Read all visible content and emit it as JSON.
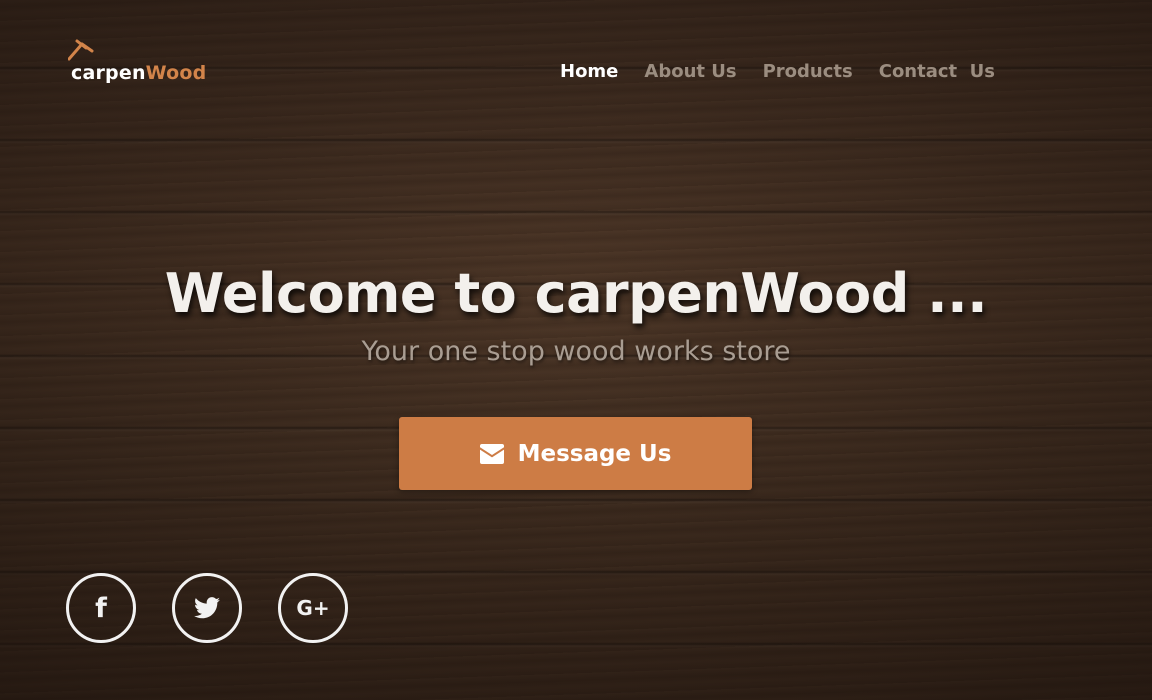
{
  "brand": {
    "name_part1": "carpen",
    "name_part2": "Wood",
    "accent_color": "#d2844a",
    "logo_icon": "hammer-roof-icon"
  },
  "nav": {
    "items": [
      {
        "label": "Home",
        "active": true
      },
      {
        "label": "About Us",
        "active": false
      },
      {
        "label": "Products",
        "active": false
      },
      {
        "label": "Contact  Us",
        "active": false
      }
    ]
  },
  "hero": {
    "title": "Welcome to carpenWood ...",
    "subtitle": "Your one stop wood works store",
    "background": "dark-wood-planks",
    "cta": {
      "label": "Message Us",
      "icon": "envelope-icon",
      "color": "#cd7c45"
    }
  },
  "social": [
    {
      "network": "facebook",
      "icon": "facebook-icon",
      "glyph": "f"
    },
    {
      "network": "twitter",
      "icon": "twitter-icon",
      "glyph": ""
    },
    {
      "network": "google-plus",
      "icon": "google-plus-icon",
      "glyph": "G+"
    }
  ]
}
